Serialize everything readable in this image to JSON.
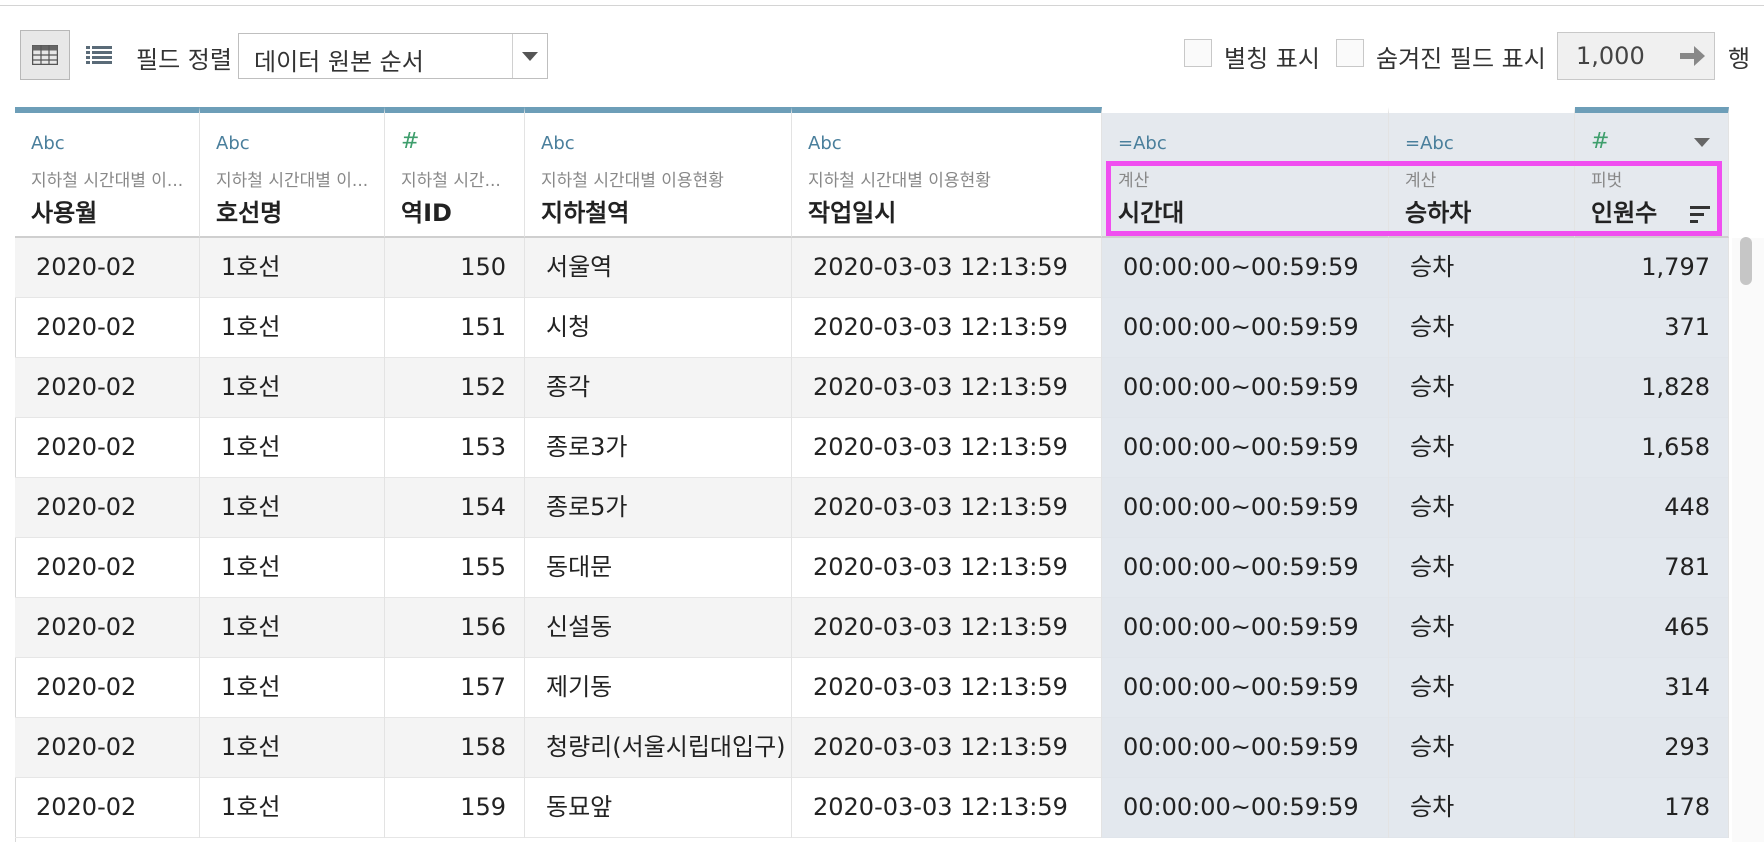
{
  "toolbar": {
    "sort_label": "필드 정렬",
    "sort_value": "데이터 원본 순서",
    "alias_label": "별칭 표시",
    "hidden_label": "숨겨진 필드 표시",
    "rows_value": "1,000",
    "rows_unit": "행"
  },
  "columns": [
    {
      "type": "Abc",
      "source": "지하철 시간대별 이...",
      "name": "사용월"
    },
    {
      "type": "Abc",
      "source": "지하철 시간대별 이...",
      "name": "호선명"
    },
    {
      "type": "#",
      "source": "지하철 시간...",
      "name": "역ID"
    },
    {
      "type": "Abc",
      "source": "지하철 시간대별 이용현황",
      "name": "지하철역"
    },
    {
      "type": "Abc",
      "source": "지하철 시간대별 이용현황",
      "name": "작업일시"
    },
    {
      "type": "=Abc",
      "source": "계산",
      "name": "시간대"
    },
    {
      "type": "=Abc",
      "source": "계산",
      "name": "승하차"
    },
    {
      "type": "#",
      "source": "피벗",
      "name": "인원수"
    }
  ],
  "rows": [
    [
      "2020-02",
      "1호선",
      "150",
      "서울역",
      "2020-03-03 12:13:59",
      "00:00:00~00:59:59",
      "승차",
      "1,797"
    ],
    [
      "2020-02",
      "1호선",
      "151",
      "시청",
      "2020-03-03 12:13:59",
      "00:00:00~00:59:59",
      "승차",
      "371"
    ],
    [
      "2020-02",
      "1호선",
      "152",
      "종각",
      "2020-03-03 12:13:59",
      "00:00:00~00:59:59",
      "승차",
      "1,828"
    ],
    [
      "2020-02",
      "1호선",
      "153",
      "종로3가",
      "2020-03-03 12:13:59",
      "00:00:00~00:59:59",
      "승차",
      "1,658"
    ],
    [
      "2020-02",
      "1호선",
      "154",
      "종로5가",
      "2020-03-03 12:13:59",
      "00:00:00~00:59:59",
      "승차",
      "448"
    ],
    [
      "2020-02",
      "1호선",
      "155",
      "동대문",
      "2020-03-03 12:13:59",
      "00:00:00~00:59:59",
      "승차",
      "781"
    ],
    [
      "2020-02",
      "1호선",
      "156",
      "신설동",
      "2020-03-03 12:13:59",
      "00:00:00~00:59:59",
      "승차",
      "465"
    ],
    [
      "2020-02",
      "1호선",
      "157",
      "제기동",
      "2020-03-03 12:13:59",
      "00:00:00~00:59:59",
      "승차",
      "314"
    ],
    [
      "2020-02",
      "1호선",
      "158",
      "청량리(서울시립대입구)",
      "2020-03-03 12:13:59",
      "00:00:00~00:59:59",
      "승차",
      "293"
    ],
    [
      "2020-02",
      "1호선",
      "159",
      "동묘앞",
      "2020-03-03 12:13:59",
      "00:00:00~00:59:59",
      "승차",
      "178"
    ]
  ],
  "colors": {
    "highlight": "#f04ef0",
    "header_bar": "#6d9eb8",
    "string_icon": "#4a7f9c",
    "number_icon": "#3e9e6c"
  }
}
